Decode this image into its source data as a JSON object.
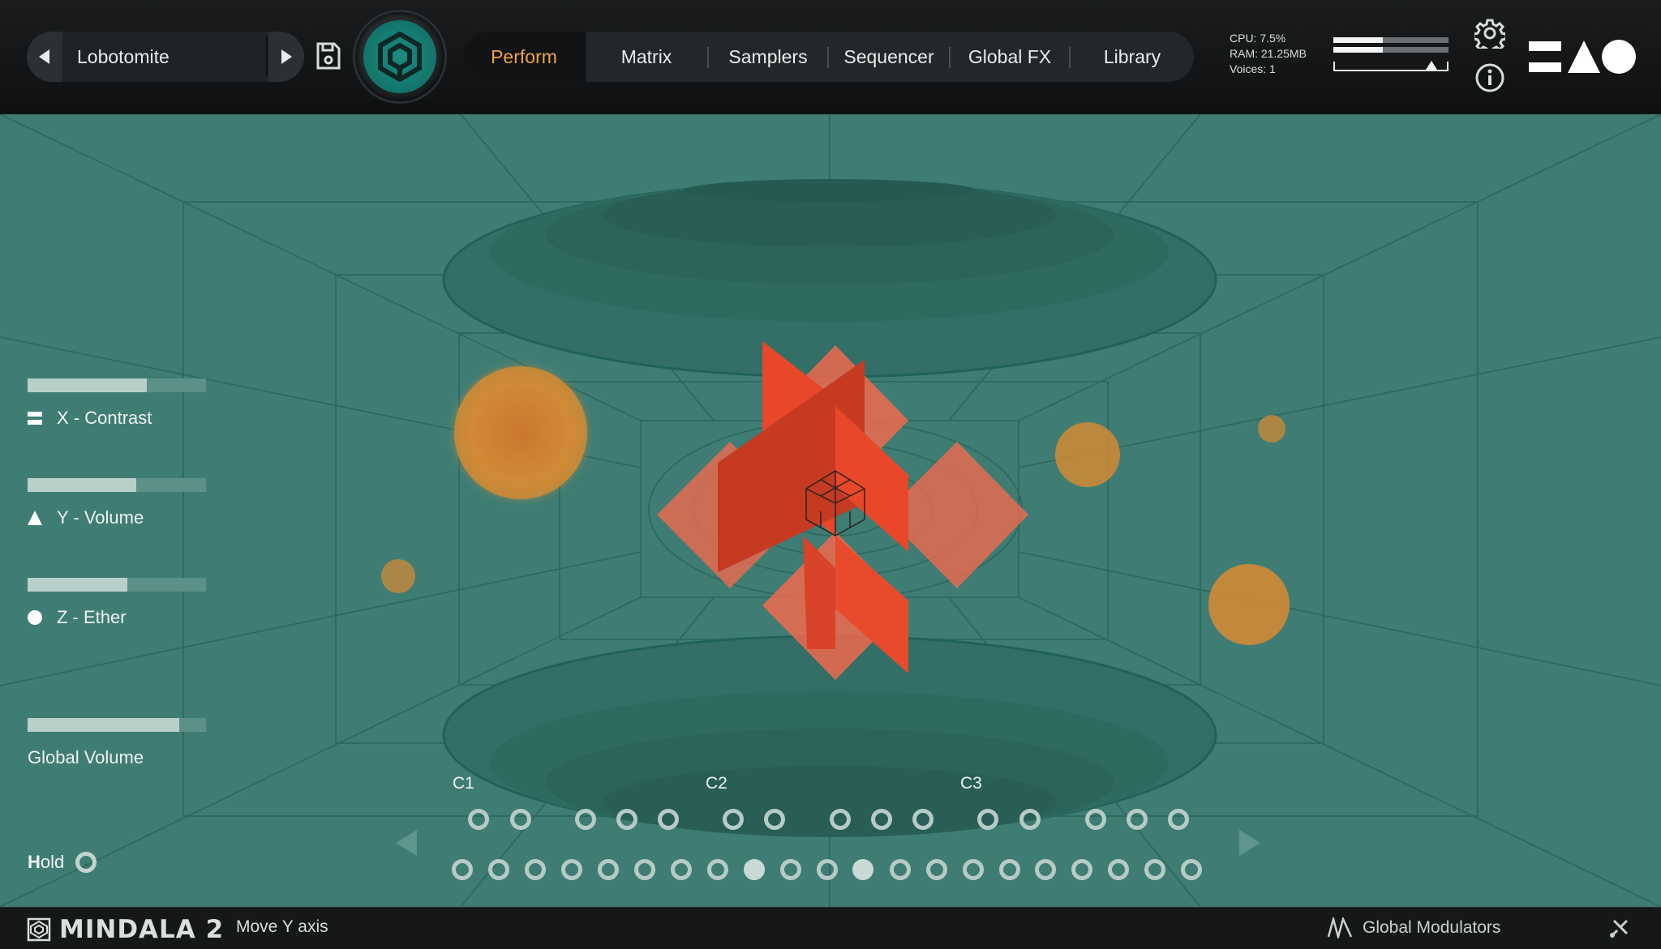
{
  "header": {
    "preset_name": "Lobotomite",
    "tabs": [
      {
        "label": "Perform",
        "active": true
      },
      {
        "label": "Matrix"
      },
      {
        "label": "Samplers"
      },
      {
        "label": "Sequencer"
      },
      {
        "label": "Global FX"
      },
      {
        "label": "Library"
      }
    ],
    "stats": {
      "cpu": "CPU: 7.5%",
      "ram": "RAM: 21.25MB",
      "voices": "Voices: 1"
    },
    "meter_level": 0.43,
    "meter_marker": 0.85
  },
  "parameters": [
    {
      "label": "X - Contrast",
      "value": 0.67,
      "icon": "equals-icon"
    },
    {
      "label": "Y - Volume",
      "value": 0.61,
      "icon": "triangle-icon"
    },
    {
      "label": "Z - Ether",
      "value": 0.56,
      "icon": "circle-icon"
    }
  ],
  "global_volume": {
    "label": "Global Volume",
    "value": 0.85
  },
  "hold": {
    "first": "H",
    "rest": "old"
  },
  "keyboard": {
    "octave_labels": [
      "C1",
      "C2",
      "C3"
    ],
    "active_bottom_keys": [
      8,
      11
    ]
  },
  "footer": {
    "brand": "MINDALA 2",
    "status": "Move Y axis",
    "modulators": "Global Modulators"
  },
  "colors": {
    "accent": "#f0a24a",
    "stage": "#3f7d74",
    "shape": "#e8472a",
    "orb": "#d18a35"
  }
}
